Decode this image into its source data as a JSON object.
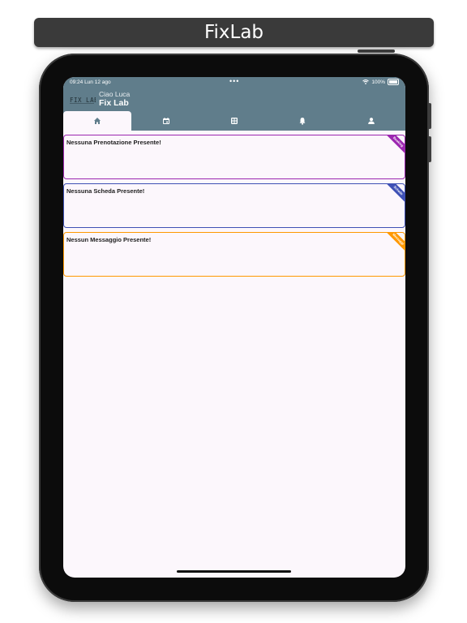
{
  "banner": {
    "title": "FixLab"
  },
  "status_bar": {
    "time": "09:24  Lun 12 ago",
    "dots": "•••",
    "battery": "100%"
  },
  "header": {
    "greeting": "Ciao Luca",
    "app_name": "Fix Lab",
    "logo_text": "FIX LAB"
  },
  "tabs": [
    {
      "icon": "home-icon",
      "active": true
    },
    {
      "icon": "calendar-icon",
      "active": false
    },
    {
      "icon": "grid-icon",
      "active": false
    },
    {
      "icon": "bell-icon",
      "active": false
    },
    {
      "icon": "person-icon",
      "active": false
    }
  ],
  "cards": [
    {
      "text": "Nessuna Prenotazione Presente!",
      "ribbon": "Booking",
      "color": "#9c27b0"
    },
    {
      "text": "Nessuna Scheda Presente!",
      "ribbon": "Schede",
      "color": "#3f51b5"
    },
    {
      "text": "Nessun Messaggio Presente!",
      "ribbon": "Messaggi",
      "color": "#ff9800"
    }
  ],
  "colors": {
    "appbar": "#607d8b",
    "background": "#fcf7fc"
  }
}
